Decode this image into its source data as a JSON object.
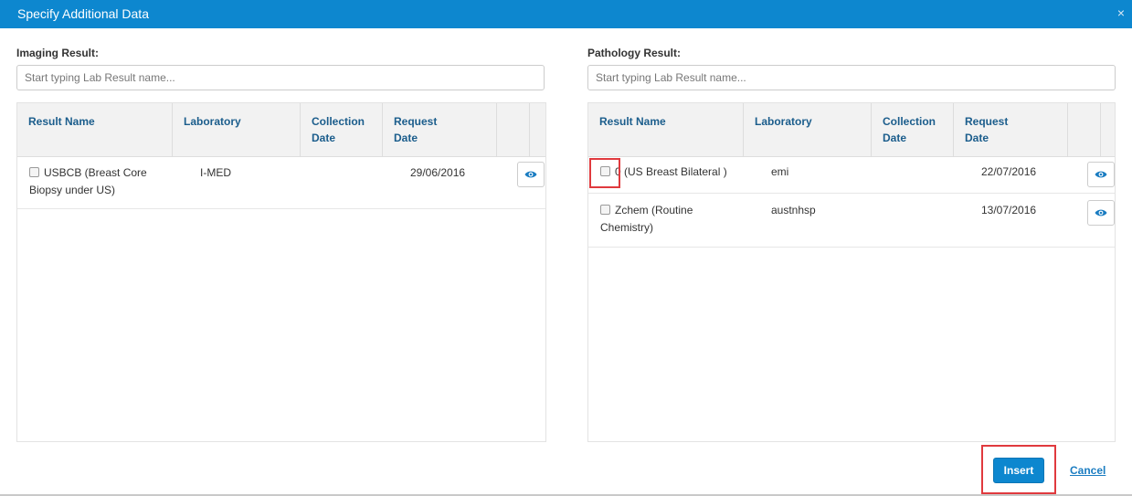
{
  "dialog": {
    "title": "Specify Additional Data",
    "close_glyph": "×"
  },
  "imaging": {
    "label": "Imaging Result:",
    "search_placeholder": "Start typing Lab Result name...",
    "columns": [
      "Result Name",
      "Laboratory",
      "Collection Date",
      "Request Date"
    ],
    "columns_lines": [
      [
        "Result Name"
      ],
      [
        "Laboratory"
      ],
      [
        "Collection",
        "Date"
      ],
      [
        "Request",
        "Date"
      ]
    ],
    "rows": [
      {
        "name_lines": [
          "USBCB (Breast Core",
          "Biopsy under US)"
        ],
        "laboratory": "I-MED",
        "collection_date": "",
        "request_date": "29/06/2016",
        "checked": false
      }
    ]
  },
  "pathology": {
    "label": "Pathology Result:",
    "search_placeholder": "Start typing Lab Result name...",
    "columns": [
      "Result Name",
      "Laboratory",
      "Collection Date",
      "Request Date"
    ],
    "columns_lines": [
      [
        "Result Name"
      ],
      [
        "Laboratory"
      ],
      [
        "Collection",
        "Date"
      ],
      [
        "Request",
        "Date"
      ]
    ],
    "rows": [
      {
        "name_lines": [
          "0 (US Breast Bilateral )"
        ],
        "laboratory": "emi",
        "collection_date": "",
        "request_date": "22/07/2016",
        "checked": false
      },
      {
        "name_lines": [
          "Zchem (Routine",
          "Chemistry)"
        ],
        "laboratory": "austnhsp",
        "collection_date": "",
        "request_date": "13/07/2016",
        "checked": false
      }
    ]
  },
  "footer": {
    "insert_label": "Insert",
    "cancel_label": "Cancel"
  },
  "icons": {
    "view": "eye-icon",
    "close": "close-icon",
    "checkbox": "checkbox-icon"
  },
  "colors": {
    "header": "#0d87cf",
    "column_header_text": "#1b5d8c",
    "highlight": "#e03a3e",
    "link": "#1a7cc1"
  }
}
